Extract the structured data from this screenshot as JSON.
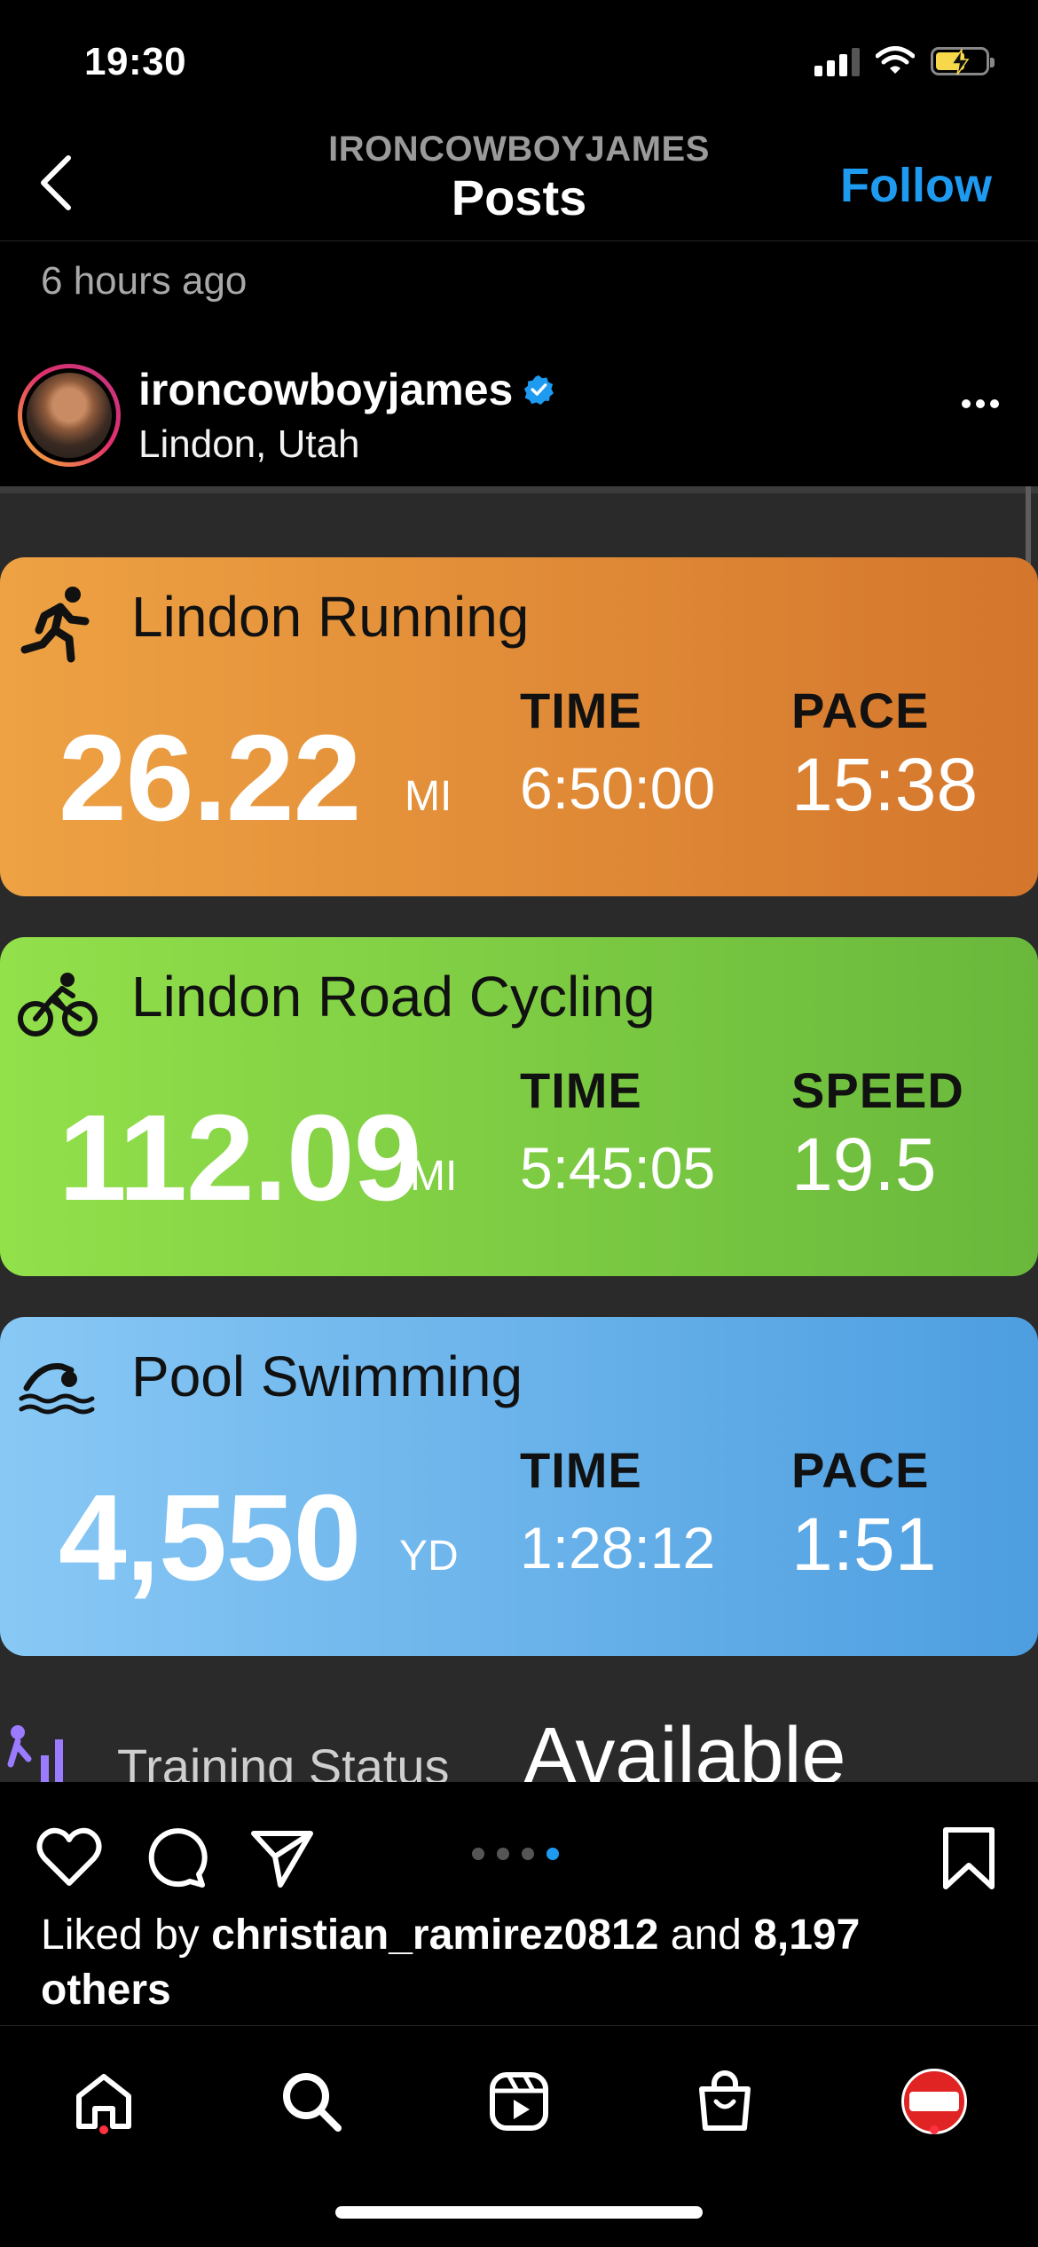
{
  "status_bar": {
    "time": "19:30"
  },
  "nav": {
    "subtitle": "IRONCOWBOYJAMES",
    "title": "Posts",
    "follow_label": "Follow"
  },
  "time_ago": "6 hours ago",
  "post": {
    "username": "ironcowboyjames",
    "location": "Lindon, Utah"
  },
  "cards": {
    "run": {
      "title": "Lindon Running",
      "distance": "26.22",
      "unit": "MI",
      "stat1_label": "TIME",
      "stat1_value": "6:50:00",
      "stat2_label": "PACE",
      "stat2_value": "15:38"
    },
    "cycle": {
      "title": "Lindon Road Cycling",
      "distance": "112.09",
      "unit": "MI",
      "stat1_label": "TIME",
      "stat1_value": "5:45:05",
      "stat2_label": "SPEED",
      "stat2_value": "19.5"
    },
    "swim": {
      "title": "Pool Swimming",
      "distance": "4,550",
      "unit": "YD",
      "stat1_label": "TIME",
      "stat1_value": "1:28:12",
      "stat2_label": "PACE",
      "stat2_value": "1:51"
    },
    "partial": {
      "label": "Training Status",
      "value": "Available"
    }
  },
  "likes": {
    "prefix": "Liked by ",
    "user": "christian_ramirez0812",
    "middle": " and ",
    "count": "8,197",
    "suffix": "others"
  },
  "carousel": {
    "total": 4,
    "active": 4
  },
  "icons": {
    "back": "chevron-left-icon",
    "verified": "verified-badge-icon",
    "more": "more-horizontal-icon",
    "like": "heart-icon",
    "comment": "comment-icon",
    "share": "send-icon",
    "save": "bookmark-icon",
    "home": "home-icon",
    "search": "search-icon",
    "reels": "reels-icon",
    "shop": "shop-bag-icon"
  },
  "colors": {
    "accent": "#1e9bf0",
    "run_card": "#e08a35",
    "cycle_card": "#7fcc44",
    "swim_card": "#6fb4ec",
    "notification_dot": "#ff3040"
  }
}
